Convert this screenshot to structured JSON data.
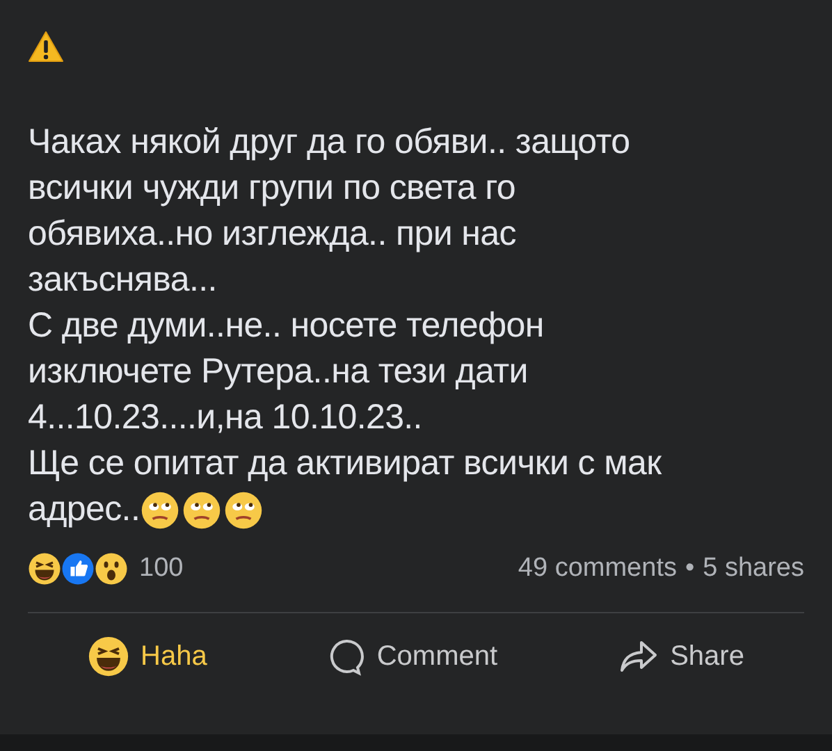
{
  "post": {
    "lines": [
      "Чаках някой друг да го обяви.. защото",
      "всички чужди групи по света го",
      "обявиха..но изглежда.. при нас",
      "закъснява...",
      "С две думи..не.. носете телефон",
      "изключете Рутера..на тези дати",
      "4...10.23....и,на 10.10.23..",
      "Ще се опитат да активират всички с мак",
      "адрес.."
    ],
    "trailing_emojis": [
      {
        "kind": "rolling-eyes"
      },
      {
        "kind": "rolling-eyes"
      },
      {
        "kind": "rolling-eyes"
      }
    ]
  },
  "reactions": {
    "icons": [
      {
        "kind": "haha"
      },
      {
        "kind": "like"
      },
      {
        "kind": "wow"
      }
    ],
    "count": "100",
    "comments": "49 comments",
    "separator": "•",
    "shares": "5 shares"
  },
  "actions": [
    {
      "kind": "haha",
      "label": "Haha",
      "selected": true
    },
    {
      "kind": "comment",
      "label": "Comment",
      "selected": false
    },
    {
      "kind": "share",
      "label": "Share",
      "selected": false
    }
  ]
}
